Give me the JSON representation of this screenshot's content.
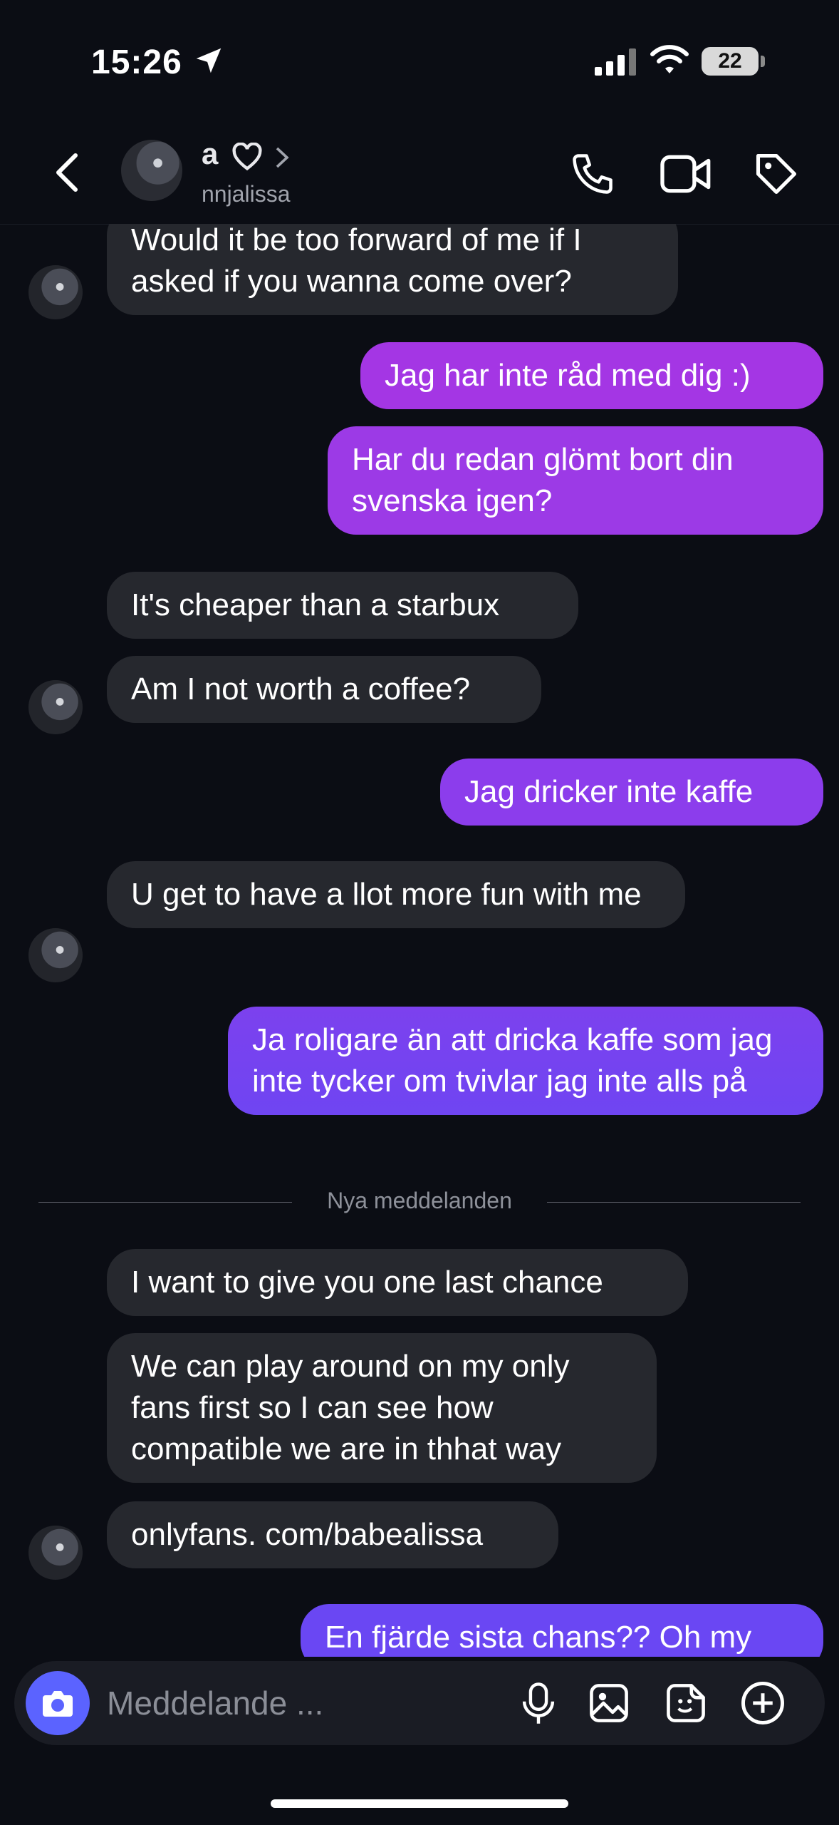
{
  "status_bar": {
    "time": "15:26",
    "battery": "22"
  },
  "header": {
    "name": "a",
    "username": "nnjalissa"
  },
  "messages": [
    {
      "dir": "in",
      "text": "Would it be too forward of me if I asked if you wanna come over?"
    },
    {
      "dir": "out",
      "text": "Jag har inte råd med dig :)"
    },
    {
      "dir": "out",
      "text": "Har du redan glömt bort din svenska igen?"
    },
    {
      "dir": "in",
      "text": "It's cheaper than a starbux"
    },
    {
      "dir": "in",
      "text": "Am I not worth a coffee?"
    },
    {
      "dir": "out",
      "text": "Jag dricker inte kaffe"
    },
    {
      "dir": "in",
      "text": "U get to have a llot more fun with me"
    },
    {
      "dir": "out",
      "text": "Ja roligare än att dricka kaffe som jag inte tycker om tvivlar jag inte alls på"
    },
    {
      "dir": "in",
      "text": "I want to give you one last chance"
    },
    {
      "dir": "in",
      "text": "We can play around on my only fans first so I can see how compatible we are in thhat way"
    },
    {
      "dir": "in",
      "text": "onlyfans. com/babealissa"
    },
    {
      "dir": "out",
      "text": "En fjärde sista chans?? Oh my"
    }
  ],
  "separator": "Nya meddelanden",
  "composer": {
    "placeholder": "Meddelande ..."
  },
  "colors": {
    "background": "#0b0d14",
    "incoming": "#26282e",
    "outgoing_top": "#a436e4",
    "outgoing_bottom": "#6f45f2",
    "camera": "#5b63ff"
  },
  "icons": [
    "location-arrow-icon",
    "signal-icon",
    "wifi-icon",
    "battery-icon",
    "back-icon",
    "heart-icon",
    "chevron-right-icon",
    "phone-icon",
    "video-icon",
    "tag-icon",
    "camera-icon",
    "mic-icon",
    "image-icon",
    "sticker-icon",
    "plus-icon"
  ]
}
